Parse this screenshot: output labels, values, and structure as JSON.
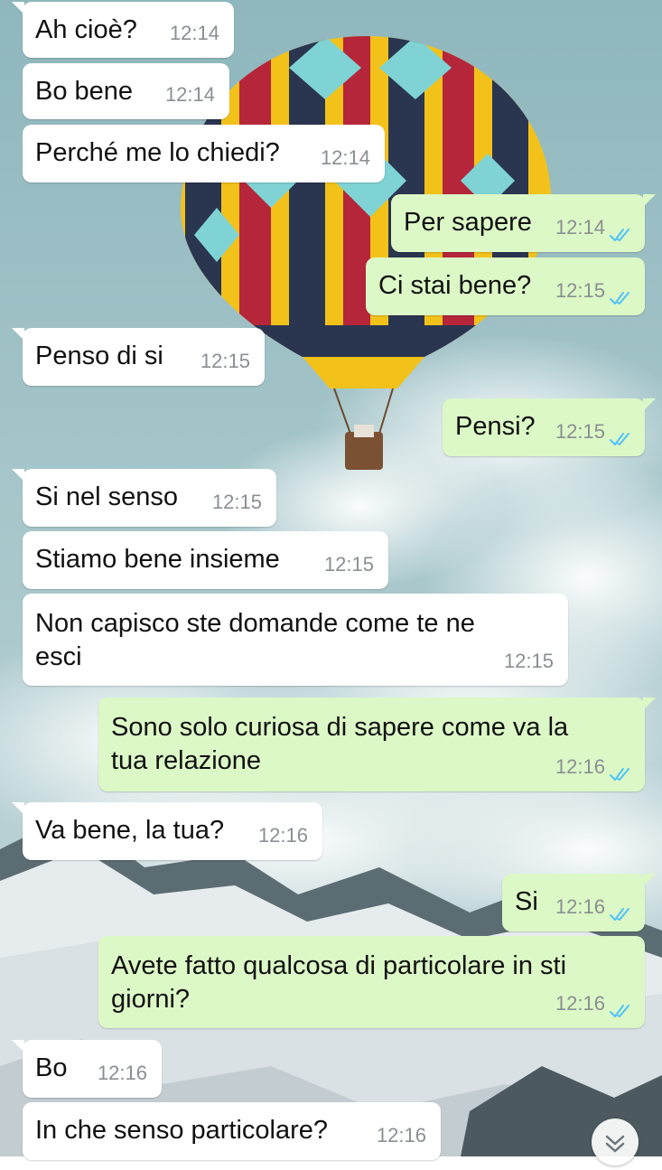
{
  "messages": [
    {
      "dir": "in",
      "text": "Ah cioè?",
      "time": "12:14"
    },
    {
      "dir": "in",
      "text": "Bo bene",
      "time": "12:14"
    },
    {
      "dir": "in",
      "text": "Perché me lo chiedi?",
      "time": "12:14"
    },
    {
      "dir": "out",
      "text": "Per sapere",
      "time": "12:14",
      "status": "read"
    },
    {
      "dir": "out",
      "text": "Ci stai bene?",
      "time": "12:15",
      "status": "read"
    },
    {
      "dir": "in",
      "text": "Penso di si",
      "time": "12:15"
    },
    {
      "dir": "out",
      "text": "Pensi?",
      "time": "12:15",
      "status": "read"
    },
    {
      "dir": "in",
      "text": "Si nel senso",
      "time": "12:15"
    },
    {
      "dir": "in",
      "text": "Stiamo bene insieme",
      "time": "12:15"
    },
    {
      "dir": "in",
      "text": "Non capisco ste domande come te ne esci",
      "time": "12:15"
    },
    {
      "dir": "out",
      "text": "Sono solo curiosa di sapere come va la tua relazione",
      "time": "12:16",
      "status": "read"
    },
    {
      "dir": "in",
      "text": "Va bene, la tua?",
      "time": "12:16"
    },
    {
      "dir": "out",
      "text": "Si",
      "time": "12:16",
      "status": "read"
    },
    {
      "dir": "out",
      "text": "Avete fatto qualcosa di particolare in sti giorni?",
      "time": "12:16",
      "status": "read"
    },
    {
      "dir": "in",
      "text": "Bo",
      "time": "12:16"
    },
    {
      "dir": "in",
      "text": "In che senso particolare?",
      "time": "12:16"
    }
  ],
  "colors": {
    "incoming_bubble": "#ffffff",
    "outgoing_bubble": "#dcf8c6",
    "read_ticks": "#4fc3f7",
    "timestamp": "#8a8f92"
  },
  "icons": {
    "read_receipt": "double-check-icon",
    "scroll_down": "chevron-double-down-icon"
  }
}
